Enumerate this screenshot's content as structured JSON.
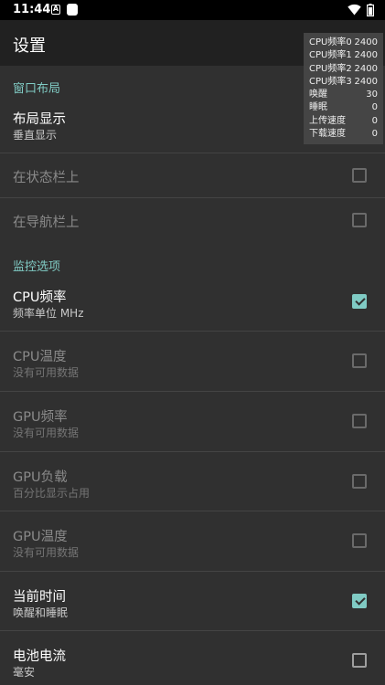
{
  "status_bar": {
    "time": "11:44",
    "notif_a": "A"
  },
  "app_bar": {
    "title": "设置"
  },
  "overlay": {
    "rows": [
      {
        "label": "CPU频率0",
        "value": "2400"
      },
      {
        "label": "CPU频率1",
        "value": "2400"
      },
      {
        "label": "CPU频率2",
        "value": "2400"
      },
      {
        "label": "CPU频率3",
        "value": "2400"
      },
      {
        "label": "唤醒",
        "value": "30"
      },
      {
        "label": "睡眠",
        "value": "0"
      },
      {
        "label": "上传速度",
        "value": "0"
      },
      {
        "label": "下载速度",
        "value": "0"
      }
    ]
  },
  "categories": {
    "window_layout": "窗口布局",
    "monitor_options": "监控选项"
  },
  "prefs": {
    "layout_display": {
      "title": "布局显示",
      "summary": "垂直显示"
    },
    "on_status_bar": {
      "title": "在状态栏上",
      "checked": false
    },
    "on_nav_bar": {
      "title": "在导航栏上",
      "checked": false
    },
    "cpu_freq": {
      "title": "CPU频率",
      "summary": "频率单位 MHz",
      "checked": true
    },
    "cpu_temp": {
      "title": "CPU温度",
      "summary": "没有可用数据",
      "checked": false
    },
    "gpu_freq": {
      "title": "GPU频率",
      "summary": "没有可用数据",
      "checked": false
    },
    "gpu_load": {
      "title": "GPU负载",
      "summary": "百分比显示占用",
      "checked": false
    },
    "gpu_temp": {
      "title": "GPU温度",
      "summary": "没有可用数据",
      "checked": false
    },
    "current_time": {
      "title": "当前时间",
      "summary": "唤醒和睡眠",
      "checked": true
    },
    "battery_current": {
      "title": "电池电流",
      "summary": "毫安",
      "checked": false
    }
  },
  "colors": {
    "accent": "#80cbc4",
    "background": "#303030",
    "app_bar": "#212121"
  }
}
